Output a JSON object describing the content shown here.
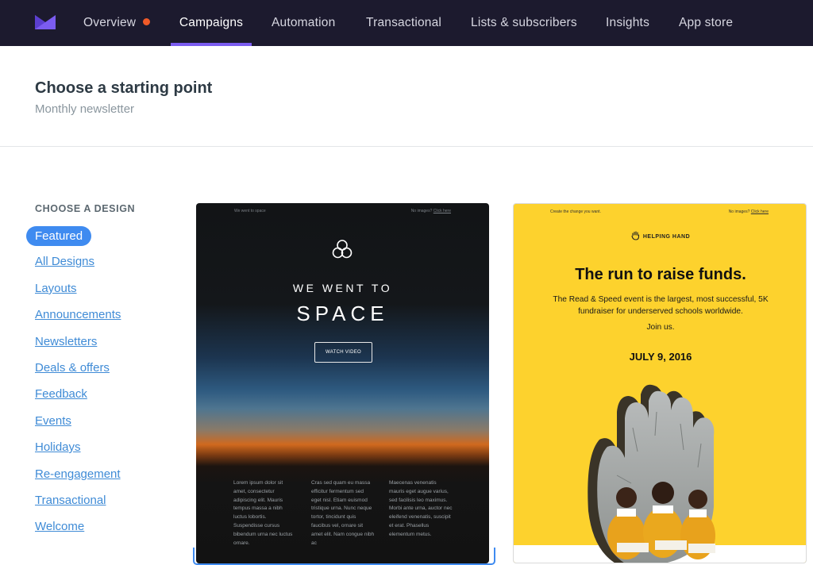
{
  "nav": {
    "items": [
      {
        "label": "Overview",
        "notification": true
      },
      {
        "label": "Campaigns",
        "active": true
      },
      {
        "label": "Automation"
      },
      {
        "label": "Transactional"
      },
      {
        "label": "Lists & subscribers"
      },
      {
        "label": "Insights"
      },
      {
        "label": "App store"
      }
    ],
    "accent_color": "#7b5cf0",
    "notification_color": "#f05a28"
  },
  "header": {
    "title": "Choose a starting point",
    "subtitle": "Monthly newsletter"
  },
  "sidebar": {
    "heading": "CHOOSE A DESIGN",
    "items": [
      {
        "label": "Featured",
        "active": true
      },
      {
        "label": "All Designs"
      },
      {
        "label": "Layouts"
      },
      {
        "label": "Announcements"
      },
      {
        "label": "Newsletters"
      },
      {
        "label": "Deals & offers"
      },
      {
        "label": "Feedback"
      },
      {
        "label": "Events"
      },
      {
        "label": "Holidays"
      },
      {
        "label": "Re-engagement"
      },
      {
        "label": "Transactional"
      },
      {
        "label": "Welcome"
      }
    ]
  },
  "templates": [
    {
      "preheader_left": "We went to space",
      "preheader_right": "No images?",
      "preheader_link": "Click here",
      "heading_small": "WE WENT TO",
      "heading_large": "SPACE",
      "button": "WATCH VIDEO",
      "columns": [
        "Lorem ipsum dolor sit amet, consectetur adipiscing elit. Mauris tempus massa a nibh luctus lobortis. Suspendisse cursus bibendum urna nec luctus ornare.",
        "Cras sed quam eu massa efficitur fermentum sed eget nisl. Etiam euismod tristique urna. Nunc neque tortor, tincidunt quis faucibus vel, ornare sit amet elit. Nam congue nibh ac",
        "Maecenas venenatis mauris eget augue varius, sed facilisis leo maximus. Morbi ante urna, auctor nec eleifend venenatis, suscipit et erat. Phasellus elementum metus."
      ]
    },
    {
      "preheader_left": "Create the change you want.",
      "preheader_right": "No images?",
      "preheader_link": "Click here",
      "brand": "HELPING HAND",
      "title": "The run to raise funds.",
      "body": "The Read & Speed event is the largest, most successful, 5K fundraiser for underserved schools worldwide.",
      "join": "Join us.",
      "date": "JULY 9, 2016",
      "background_color": "#fdd22d"
    }
  ]
}
